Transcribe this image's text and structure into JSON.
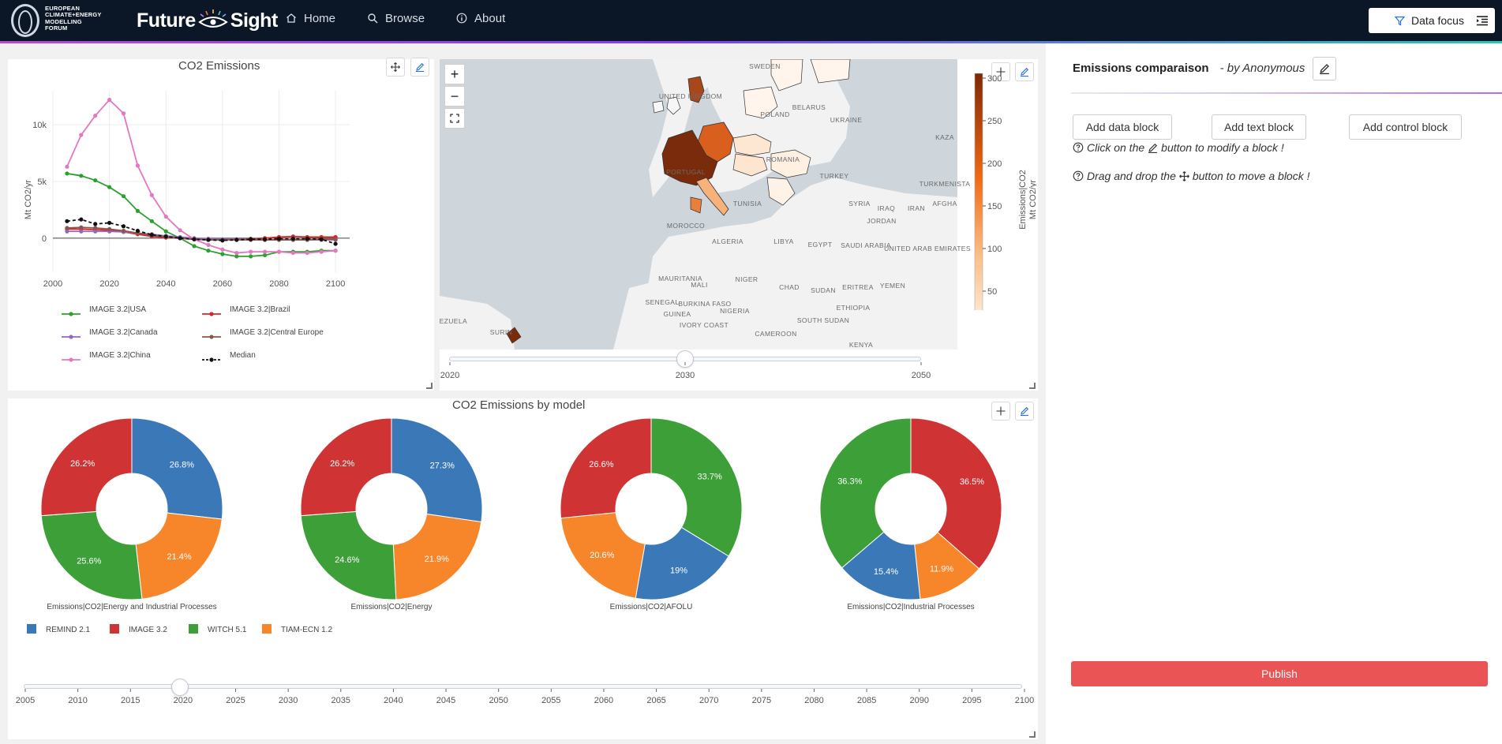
{
  "header": {
    "logo_text": [
      "EUROPEAN",
      "CLIMATE+ENERGY",
      "MODELLING",
      "FORUM"
    ],
    "brand_left": "Future",
    "brand_right": "Sight",
    "nav": [
      {
        "label": "Home",
        "icon": "home-icon"
      },
      {
        "label": "Browse",
        "icon": "search-icon"
      },
      {
        "label": "About",
        "icon": "info-icon"
      }
    ],
    "data_focus_label": "Data focus",
    "menu_icon": "indent-menu-icon"
  },
  "colors": {
    "topbar": "#0b1727",
    "publish": "#ea5455",
    "green": "#2ca02c",
    "red": "#d62728",
    "purple": "#9467bd",
    "brown": "#8c564b",
    "pink": "#e377c2",
    "blue": "#1f77b4",
    "orange": "#ff7f0e"
  },
  "line_panel": {
    "title": "CO2 Emissions",
    "ylabel": "Mt CO2/yr",
    "chart_data": {
      "type": "line",
      "x": [
        2005,
        2010,
        2015,
        2020,
        2025,
        2030,
        2035,
        2040,
        2045,
        2050,
        2055,
        2060,
        2065,
        2070,
        2075,
        2080,
        2085,
        2090,
        2095,
        2100
      ],
      "xticks": [
        2000,
        2020,
        2040,
        2060,
        2080,
        2100
      ],
      "yticks": [
        0,
        5000,
        10000
      ],
      "ytick_labels": [
        "0",
        "5k",
        "10k"
      ],
      "xlim": [
        2000,
        2105
      ],
      "ylim": [
        -3000,
        13000
      ],
      "ylabel": "Mt CO2/yr",
      "series": [
        {
          "name": "IMAGE 3.2|USA",
          "color": "#2ca02c",
          "dash": false,
          "values": [
            5700,
            5500,
            5100,
            4500,
            3700,
            2400,
            1500,
            600,
            0,
            -700,
            -1100,
            -1400,
            -1600,
            -1600,
            -1500,
            -1200,
            -1200,
            -1200,
            -1100,
            -1100
          ]
        },
        {
          "name": "IMAGE 3.2|Brazil",
          "color": "#d62728",
          "dash": false,
          "values": [
            800,
            800,
            750,
            700,
            550,
            350,
            150,
            50,
            0,
            -100,
            -150,
            -150,
            -100,
            -50,
            0,
            100,
            150,
            100,
            100,
            100
          ]
        },
        {
          "name": "IMAGE 3.2|Canada",
          "color": "#9467bd",
          "dash": false,
          "values": [
            600,
            600,
            600,
            600,
            550,
            450,
            350,
            200,
            100,
            0,
            -50,
            -100,
            -100,
            -100,
            -150,
            -150,
            -150,
            -150,
            -150,
            -150
          ]
        },
        {
          "name": "IMAGE 3.2|Central Europe",
          "color": "#8c564b",
          "dash": false,
          "values": [
            900,
            950,
            900,
            800,
            650,
            450,
            250,
            100,
            0,
            -100,
            -150,
            -150,
            -150,
            -150,
            -150,
            -150,
            -150,
            -150,
            -100,
            -100
          ]
        },
        {
          "name": "IMAGE 3.2|China",
          "color": "#e377c2",
          "dash": false,
          "values": [
            6300,
            9100,
            10800,
            12200,
            11000,
            6400,
            3800,
            1900,
            700,
            -100,
            -600,
            -1000,
            -1300,
            -1200,
            -1200,
            -1200,
            -1300,
            -1300,
            -1200,
            -1100
          ]
        },
        {
          "name": "Median",
          "color": "#111111",
          "dash": true,
          "values": [
            1500,
            1650,
            1250,
            1350,
            1050,
            650,
            300,
            150,
            0,
            -100,
            -150,
            -200,
            -150,
            -100,
            -100,
            -50,
            -50,
            -50,
            -100,
            -500
          ]
        }
      ]
    }
  },
  "map_panel": {
    "labels": [
      "SWEDEN",
      "UNITED KINGDOM",
      "BELARUS",
      "POLAND",
      "UKRAINE",
      "KAZA",
      "ROMANIA",
      "PORTUGAL",
      "TURKEY",
      "TURKMENISTA",
      "TUNISIA",
      "SYRIA",
      "IRAQ",
      "IRAN",
      "AFGHA",
      "MOROCCO",
      "JORDAN",
      "ALGERIA",
      "LIBYA",
      "EGYPT",
      "SAUDI ARABIA",
      "UNITED ARAB EMIRATES",
      "MAURITANIA",
      "MALI",
      "NIGER",
      "CHAD",
      "SUDAN",
      "ERITREA",
      "YEMEN",
      "SENEGAL",
      "BURKINA FASO",
      "GUINEA",
      "IVORY COAST",
      "NIGERIA",
      "SOUTH SUDAN",
      "ETHIOPIA",
      "CAMEROON",
      "KENYA",
      "VENEZUELA",
      "SURIN"
    ],
    "colorbar": {
      "title_line1": "Emissions|CO2",
      "title_line2": "Mt CO2/yr",
      "ticks": [
        "300",
        "250",
        "200",
        "150",
        "100",
        "50"
      ]
    },
    "zoom_in": "+",
    "zoom_out": "−",
    "slider": {
      "ticks": [
        "2020",
        "2030",
        "2050"
      ],
      "value": 2030
    }
  },
  "pie_panel": {
    "title": "CO2 Emissions by model",
    "legend": [
      {
        "name": "REMIND 2.1",
        "color": "#3b78b8"
      },
      {
        "name": "IMAGE 3.2",
        "color": "#d03333"
      },
      {
        "name": "WITCH 5.1",
        "color": "#3c9f38"
      },
      {
        "name": "TIAM-ECN 1.2",
        "color": "#f7862a"
      }
    ],
    "chart_data": [
      {
        "type": "pie",
        "title": "Emissions|CO2|Energy and Industrial Processes",
        "slices": [
          {
            "name": "REMIND 2.1",
            "value": 26.8,
            "label": "26.8%"
          },
          {
            "name": "TIAM-ECN 1.2",
            "value": 21.4,
            "label": "21.4%"
          },
          {
            "name": "WITCH 5.1",
            "value": 25.6,
            "label": "25.6%"
          },
          {
            "name": "IMAGE 3.2",
            "value": 26.2,
            "label": "26.2%"
          }
        ]
      },
      {
        "type": "pie",
        "title": "Emissions|CO2|Energy",
        "slices": [
          {
            "name": "REMIND 2.1",
            "value": 27.3,
            "label": "27.3%"
          },
          {
            "name": "TIAM-ECN 1.2",
            "value": 21.9,
            "label": "21.9%"
          },
          {
            "name": "WITCH 5.1",
            "value": 24.6,
            "label": "24.6%"
          },
          {
            "name": "IMAGE 3.2",
            "value": 26.2,
            "label": "26.2%"
          }
        ]
      },
      {
        "type": "pie",
        "title": "Emissions|CO2|AFOLU",
        "slices": [
          {
            "name": "WITCH 5.1",
            "value": 33.7,
            "label": "33.7%"
          },
          {
            "name": "REMIND 2.1",
            "value": 19,
            "label": "19%"
          },
          {
            "name": "TIAM-ECN 1.2",
            "value": 20.6,
            "label": "20.6%"
          },
          {
            "name": "IMAGE 3.2",
            "value": 26.6,
            "label": "26.6%"
          }
        ]
      },
      {
        "type": "pie",
        "title": "Emissions|CO2|Industrial Processes",
        "slices": [
          {
            "name": "IMAGE 3.2",
            "value": 36.5,
            "label": "36.5%"
          },
          {
            "name": "TIAM-ECN 1.2",
            "value": 11.9,
            "label": "11.9%"
          },
          {
            "name": "REMIND 2.1",
            "value": 15.4,
            "label": "15.4%"
          },
          {
            "name": "WITCH 5.1",
            "value": 36.3,
            "label": "36.3%"
          }
        ]
      }
    ],
    "slider": {
      "ticks": [
        "2005",
        "2010",
        "2015",
        "2020",
        "2025",
        "2030",
        "2035",
        "2040",
        "2045",
        "2050",
        "2055",
        "2060",
        "2065",
        "2070",
        "2075",
        "2080",
        "2085",
        "2090",
        "2095",
        "2100"
      ],
      "value": 2020
    }
  },
  "side": {
    "title": "Emissions comparaison",
    "author": "- by Anonymous",
    "buttons": [
      "Add data block",
      "Add text block",
      "Add control block"
    ],
    "hint1_pre": "Click on the",
    "hint1_post": "button to modify a block !",
    "hint2_pre": "Drag and drop the",
    "hint2_post": "button to move a block !",
    "publish": "Publish"
  }
}
